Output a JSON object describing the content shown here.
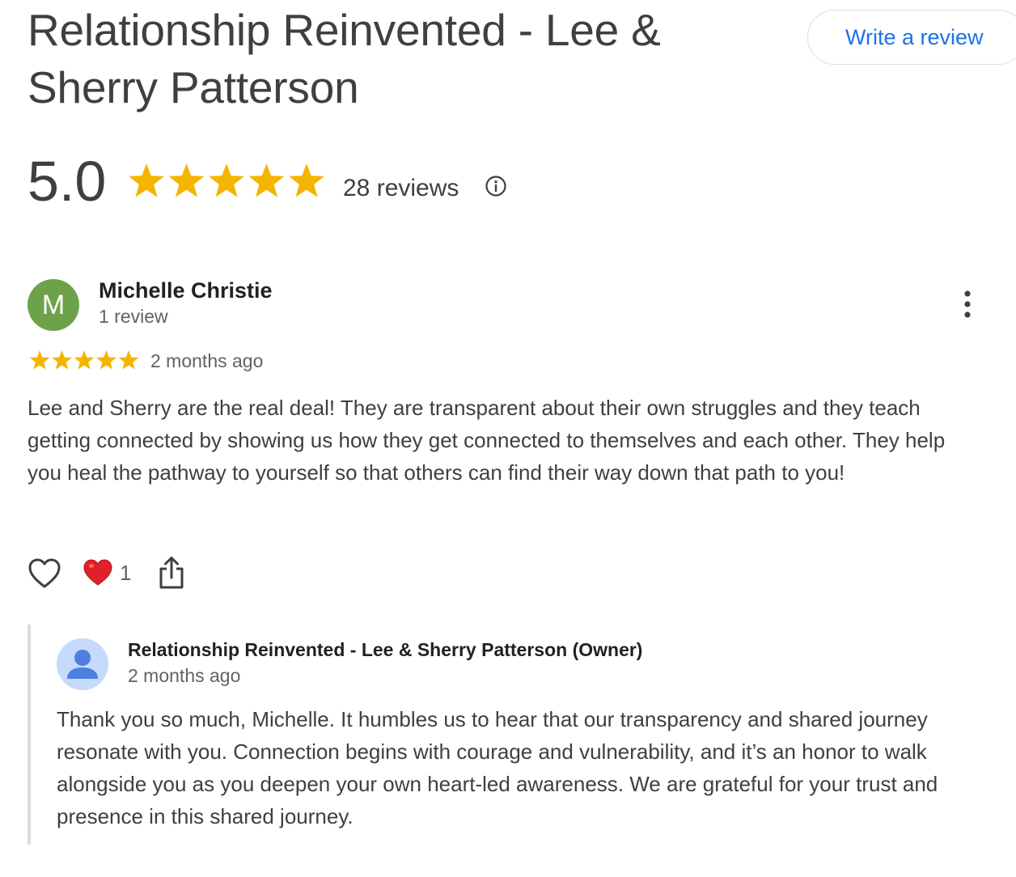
{
  "business": {
    "title": "Relationship Reinvented - Lee & Sherry Patterson",
    "write_review_label": "Write a review",
    "rating": "5.0",
    "stars_out_of_5": 5,
    "review_count": "28 reviews",
    "star_color": "#f4b400"
  },
  "review": {
    "avatar_letter": "M",
    "avatar_color": "#6da24a",
    "author": "Michelle Christie",
    "author_sub": "1 review",
    "stars_out_of_5": 5,
    "date": "2 months ago",
    "text": "Lee and Sherry are the real deal! They are transparent about their own struggles and they teach getting connected by showing us how they get connected to themselves and each other. They help you heal the pathway to yourself so that others can find their way down that path to you!",
    "reaction_count": "1"
  },
  "owner_reply": {
    "name": "Relationship Reinvented - Lee & Sherry Patterson (Owner)",
    "date": "2 months ago",
    "text": "Thank you so much, Michelle. It humbles us to hear that our transparency and shared journey resonate with you. Connection begins with courage and vulnerability, and it’s an honor to walk alongside you as you deepen your own heart-led awareness. We are grateful for your trust and presence in this shared journey."
  },
  "icons": {
    "info": "info-icon",
    "more": "more-vert-icon",
    "like": "heart-outline-icon",
    "reaction": "red-heart-icon",
    "share": "share-icon",
    "owner_avatar": "person-icon"
  }
}
